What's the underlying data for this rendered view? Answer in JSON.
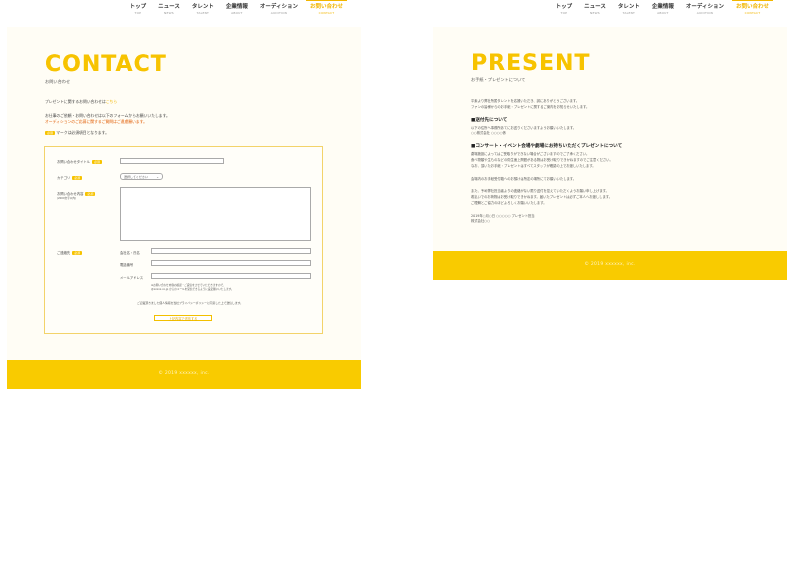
{
  "nav": {
    "items": [
      {
        "ja": "トップ",
        "en": "TOP"
      },
      {
        "ja": "ニュース",
        "en": "NEWS"
      },
      {
        "ja": "タレント",
        "en": "TALENT"
      },
      {
        "ja": "企業情報",
        "en": "ABOUT"
      },
      {
        "ja": "オーディション",
        "en": "AUDITION"
      },
      {
        "ja": "お問い合わせ",
        "en": "CONTACT"
      }
    ],
    "active_index": 5
  },
  "contact": {
    "title": "CONTACT",
    "subtitle": "お問い合わせ",
    "intro_present_prefix": "プレゼントに関するお問い合わせは",
    "intro_present_link": "こちら",
    "intro_line2": "お仕事のご依頼・お問い合わせは以下のフォームからお願いいたします。",
    "intro_line3_red": "オーディションのご応募に関するご質問はご遠慮願います。",
    "required_badge": "必須",
    "required_note": "マークは必須項目となります。",
    "form": {
      "subject_label": "お問い合わせタイトル",
      "category_label": "カテゴリ",
      "category_placeholder": "選択してください",
      "body_label": "お問い合わせ内容",
      "body_sub": "(2000文字以内)",
      "contact_label": "ご連絡先",
      "name_label": "会社名・氏名",
      "phone_label": "電話番号",
      "email_label": "メールアドレス",
      "email_note1": "※お問い合わせ内容の確認・ご返信をさせていただきますので、",
      "email_note2": "@xxxxx.co.jp からのメールを受信できるように設定願いいたします。",
      "agree_text": "ご記載頂きました個人情報を当社プライバシーポリシーに同意した上で送信します。",
      "submit_label": "上記内容で送信する"
    },
    "footer": "© 2019 xxxxxx, inc."
  },
  "present": {
    "title": "PRESENT",
    "subtitle": "お手紙・プレゼントについて",
    "line1": "平素より弊社所属タレントを応援いただき、誠にありがとうございます。",
    "line2": "ファンの皆様からのお手紙・プレゼントに関するご案内をお知らせいたします。",
    "head1": "■送付先について",
    "addr1": "以下の住所へ事務所あてにお送りくださいますようお願いいたします。",
    "addr2": "○○株式会社 ○○○○係",
    "head2": "■コンサート・イベント会場や劇場にお持ちいただくプレゼントについて",
    "p1": "劇場施設によってはご受取りができない場合がございますのでご了承ください。",
    "p2": "食べ物類や生ものなどの衛生面上問題がある物はお受け取りできかねますのでご注意ください。",
    "p3": "なお、頂いたお手紙・プレゼントはすべてスタッフが確認の上でお渡しいたします。",
    "p4": "会場内のお手紙受付箱へのお預けは所定の場所にてお願いいたします。",
    "p5": "また、予め弊社担当者よりの連絡がない限り送付を控えていただくようお願い申し上げます。",
    "p6": "着払いでのお荷物はお受け取りできかねます。届いたプレゼントは必ずご本人へお渡しします。",
    "p7": "ご理解とご協力のほどよろしくお願いいたします。",
    "p8": "2019年○月○日 ○○○○○ プレゼント担当",
    "p9": "株式会社○○",
    "footer": "© 2019 xxxxxx, inc."
  },
  "colors": {
    "accent": "#f7c300",
    "footer": "#f9cb00",
    "warning": "#e05a00"
  }
}
